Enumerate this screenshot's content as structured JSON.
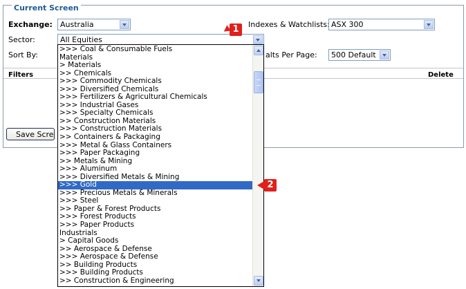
{
  "panel": {
    "title": "Current Screen"
  },
  "exchange": {
    "label": "Exchange:",
    "value": "Australia"
  },
  "indexes": {
    "label": "Indexes & Watchlists:",
    "value": "ASX 300"
  },
  "sector": {
    "label": "Sector:",
    "value": "All Equities"
  },
  "sort": {
    "label": "Sort By:"
  },
  "results": {
    "label": "alts Per Page:",
    "value": "500 Default"
  },
  "filters": {
    "label": "Filters",
    "delete_label": "Delete"
  },
  "save_button": {
    "label": "Save Screen"
  },
  "dropdown": {
    "items": [
      ">>> Coal & Consumable Fuels",
      "Materials",
      "> Materials",
      ">> Chemicals",
      ">>> Commodity Chemicals",
      ">>> Diversified Chemicals",
      ">>> Fertilizers & Agricultural Chemicals",
      ">>> Industrial Gases",
      ">>> Specialty Chemicals",
      ">> Construction Materials",
      ">>> Construction Materials",
      ">> Containers & Packaging",
      ">>> Metal & Glass Containers",
      ">>> Paper Packaging",
      ">> Metals & Mining",
      ">>> Aluminum",
      ">>> Diversified Metals & Mining",
      ">>> Gold",
      ">>> Precious Metals & Minerals",
      ">>> Steel",
      ">> Paper & Forest Products",
      ">>> Forest Products",
      ">>> Paper Products",
      "Industrials",
      "> Capital Goods",
      ">> Aerospace & Defense",
      ">>> Aerospace & Defense",
      ">> Building Products",
      ">>> Building Products",
      ">> Construction & Engineering"
    ],
    "selected_index": 17
  },
  "annotations": {
    "badge1": "1",
    "badge2": "2"
  },
  "colors": {
    "title": "#1f5a96",
    "selection": "#316ac5",
    "badge": "#e0201b"
  }
}
